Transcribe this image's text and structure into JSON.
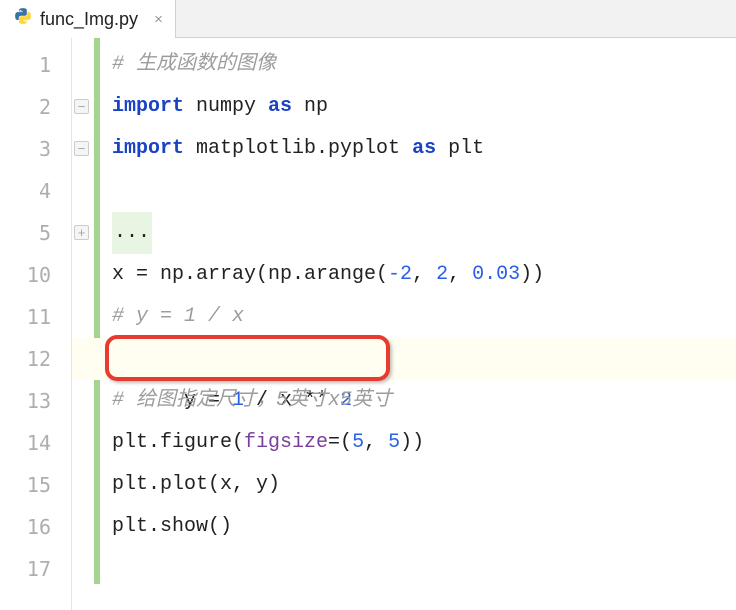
{
  "tab": {
    "filename": "func_Img.py",
    "close_label": "×"
  },
  "lines": {
    "ln1": "1",
    "ln2": "2",
    "ln3": "3",
    "ln4": "4",
    "ln5": "5",
    "ln10": "10",
    "ln11": "11",
    "ln12": "12",
    "ln13": "13",
    "ln14": "14",
    "ln15": "15",
    "ln16": "16",
    "ln17": "17"
  },
  "code": {
    "l1_comment": "# 生成函数的图像",
    "l2_kw": "import",
    "l2_mid": " numpy ",
    "l2_as": "as",
    "l2_alias": " np",
    "l3_kw": "import",
    "l3_mid": " matplotlib.pyplot ",
    "l3_as": "as",
    "l3_alias": " plt",
    "l5_folded": "...",
    "l10_a": "x = np.array(np.arange(",
    "l10_n1": "-2",
    "l10_c1": ", ",
    "l10_n2": "2",
    "l10_c2": ", ",
    "l10_n3": "0.03",
    "l10_b": "))",
    "l11_comment": "# y = 1 / x",
    "l12_a": "y = ",
    "l12_n1": "1",
    "l12_b": " / x ** ",
    "l12_n2": "2",
    "l13_comment": "# 给图指定尺寸，5英寸x5英寸",
    "l14_a": "plt.figure(",
    "l14_kw": "figsize",
    "l14_eq": "=(",
    "l14_n1": "5",
    "l14_c": ", ",
    "l14_n2": "5",
    "l14_b": "))",
    "l15": "plt.plot(x, y)",
    "l16": "plt.show()"
  }
}
